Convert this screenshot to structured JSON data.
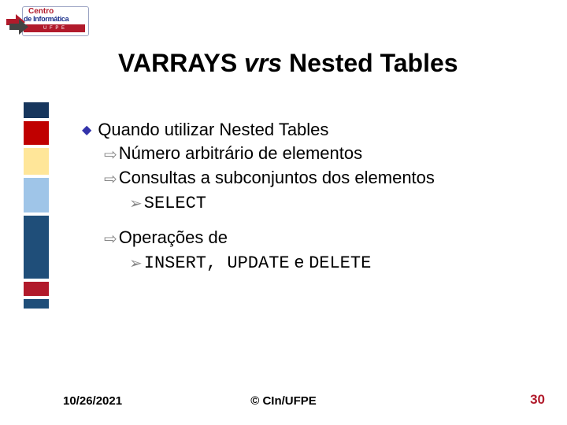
{
  "logo": {
    "line1": "Centro",
    "line2": "de Informática",
    "bar": "U F P E"
  },
  "title": {
    "part1": "VARRAYS ",
    "italic": "vrs",
    "part2": " Nested Tables"
  },
  "body": {
    "l1": "Quando utilizar Nested Tables",
    "l2a": "Número arbitrário de elementos",
    "l2b": "Consultas a subconjuntos dos elementos",
    "l3a": "SELECT",
    "l2c": "Operações de",
    "l3b_mono1": "INSERT",
    "l3b_sep1": ", ",
    "l3b_mono2": "UPDATE",
    "l3b_txt": " e ",
    "l3b_mono3": "DELETE"
  },
  "footer": {
    "date": "10/26/2021",
    "center": "© CIn/UFPE",
    "page": "30"
  }
}
